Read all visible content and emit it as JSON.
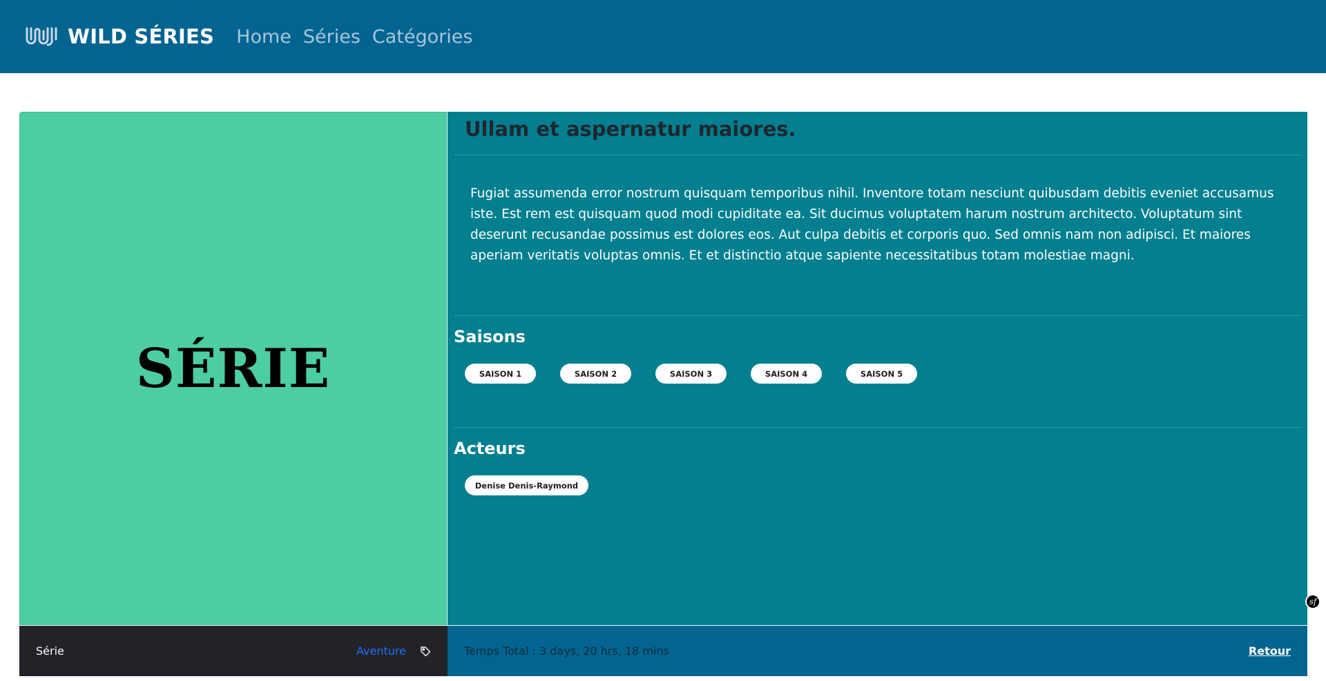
{
  "navbar": {
    "logo_icon": "wave-w-logo-icon",
    "brand": "WILD SÉRIES",
    "links": [
      "Home",
      "Séries",
      "Catégories"
    ]
  },
  "program": {
    "poster_text": "SÉRIE",
    "title": "Ullam et aspernatur maiores.",
    "description": "Fugiat assumenda error nostrum quisquam temporibus nihil. Inventore totam nesciunt quibusdam debitis eveniet accusamus iste. Est rem est quisquam quod modi cupiditate ea. Sit ducimus voluptatem harum nostrum architecto. Voluptatum sint deserunt recusandae possimus est dolores eos. Aut culpa debitis et corporis quo. Sed omnis nam non adipisci. Et maiores aperiam veritatis voluptas omnis. Et et distinctio atque sapiente necessitatibus totam molestiae magni.",
    "seasons_title": "Saisons",
    "seasons": [
      "SAISON 1",
      "SAISON 2",
      "SAISON 3",
      "SAISON 4",
      "SAISON 5"
    ],
    "actors_title": "Acteurs",
    "actors": [
      "Denise Denis-Raymond"
    ]
  },
  "footer": {
    "type_label": "Série",
    "category": "Aventure",
    "category_icon": "tag-icon",
    "total_time": "Temps Total : 3 days, 20 hrs, 18 mins",
    "back_label": "Retour"
  },
  "debug_badge": "sf",
  "colors": {
    "navbar": "#036491",
    "poster": "#4ccea2",
    "card_body": "#037f8f",
    "footer_dark": "#212329",
    "category_link": "#1f6ff5"
  }
}
